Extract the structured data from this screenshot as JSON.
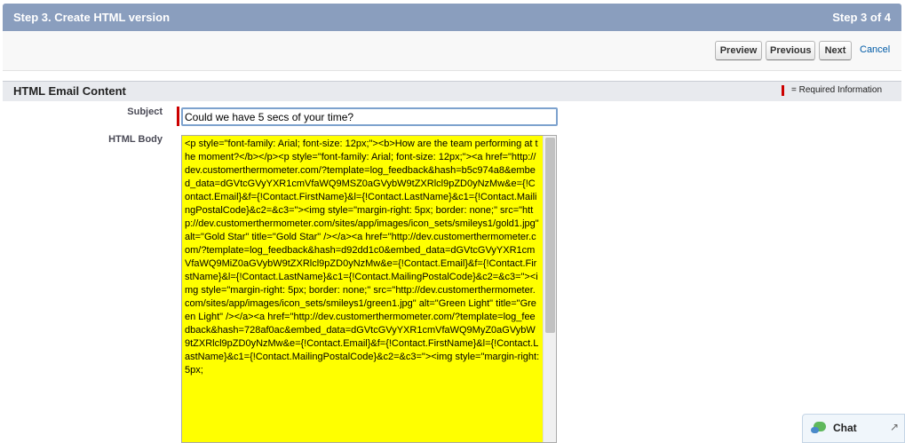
{
  "header": {
    "title": "Step 3. Create HTML version",
    "step_counter": "Step 3 of 4"
  },
  "toolbar": {
    "preview": "Preview",
    "previous": "Previous",
    "next": "Next",
    "cancel": "Cancel"
  },
  "section": {
    "title": "HTML Email Content",
    "required_info": "= Required Information"
  },
  "form": {
    "subject_label": "Subject",
    "subject_value": "Could we have 5 secs of your time?",
    "body_label": "HTML Body",
    "body_value": "<p style=\"font-family: Arial; font-size: 12px;\"><b>How are the team performing at the moment?</b></p><p style=\"font-family: Arial; font-size: 12px;\"><a href=\"http://dev.customerthermometer.com/?template=log_feedback&hash=b5c974a8&embed_data=dGVtcGVyYXR1cmVfaWQ9MSZ0aGVybW9tZXRlcl9pZD0yNzMw&e={!Contact.Email}&f={!Contact.FirstName}&l={!Contact.LastName}&c1={!Contact.MailingPostalCode}&c2=&c3=\"><img style=\"margin-right: 5px; border: none;\" src=\"http://dev.customerthermometer.com/sites/app/images/icon_sets/smileys1/gold1.jpg\" alt=\"Gold Star\" title=\"Gold Star\" /></a><a href=\"http://dev.customerthermometer.com/?template=log_feedback&hash=d92dd1c0&embed_data=dGVtcGVyYXR1cmVfaWQ9MiZ0aGVybW9tZXRlcl9pZD0yNzMw&e={!Contact.Email}&f={!Contact.FirstName}&l={!Contact.LastName}&c1={!Contact.MailingPostalCode}&c2=&c3=\"><img style=\"margin-right: 5px; border: none;\" src=\"http://dev.customerthermometer.com/sites/app/images/icon_sets/smileys1/green1.jpg\" alt=\"Green Light\" title=\"Green Light\" /></a><a href=\"http://dev.customerthermometer.com/?template=log_feedback&hash=728af0ac&embed_data=dGVtcGVyYXR1cmVfaWQ9MyZ0aGVybW9tZXRlcl9pZD0yNzMw&e={!Contact.Email}&f={!Contact.FirstName}&l={!Contact.LastName}&c1={!Contact.MailingPostalCode}&c2=&c3=\"><img style=\"margin-right: 5px;"
  },
  "chat": {
    "label": "Chat",
    "expand_icon": "expand-arrow-icon"
  },
  "colors": {
    "header_bg": "#8a9ebe",
    "required": "#cc0000",
    "body_highlight": "#ffff00",
    "link": "#015ba7"
  }
}
